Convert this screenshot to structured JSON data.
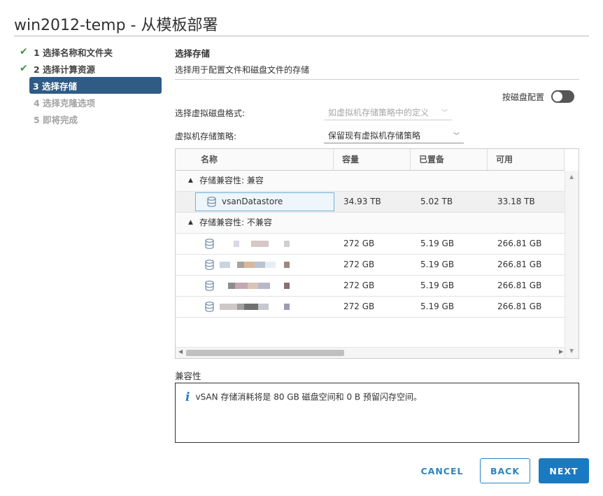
{
  "window": {
    "title": "win2012-temp - 从模板部署"
  },
  "steps": [
    {
      "label": "1 选择名称和文件夹",
      "state": "done"
    },
    {
      "label": "2 选择计算资源",
      "state": "done"
    },
    {
      "label": "3 选择存储",
      "state": "active"
    },
    {
      "label": "4 选择克隆选项",
      "state": "pending"
    },
    {
      "label": "5 即将完成",
      "state": "pending"
    }
  ],
  "section": {
    "title": "选择存储",
    "subtitle": "选择用于配置文件和磁盘文件的存储"
  },
  "toggle": {
    "label": "按磁盘配置",
    "on": false
  },
  "disk_format": {
    "label": "选择虚拟磁盘格式:",
    "value": "如虚拟机存储策略中的定义"
  },
  "vm_policy": {
    "label": "虚拟机存储策略:",
    "value": "保留现有虚拟机存储策略"
  },
  "grid": {
    "columns": [
      "名称",
      "容量",
      "已置备",
      "可用"
    ],
    "groups": [
      {
        "label": "存储兼容性: 兼容",
        "rows": [
          {
            "name": "vsanDatastore",
            "capacity": "34.93 TB",
            "provisioned": "5.02 TB",
            "free": "33.18 TB"
          }
        ]
      },
      {
        "label": "存储兼容性: 不兼容",
        "rows": [
          {
            "name": "",
            "capacity": "272 GB",
            "provisioned": "5.19 GB",
            "free": "266.81 GB"
          },
          {
            "name": "",
            "capacity": "272 GB",
            "provisioned": "5.19 GB",
            "free": "266.81 GB"
          },
          {
            "name": "",
            "capacity": "272 GB",
            "provisioned": "5.19 GB",
            "free": "266.81 GB"
          },
          {
            "name": "",
            "capacity": "272 GB",
            "provisioned": "5.19 GB",
            "free": "266.81 GB"
          }
        ]
      }
    ]
  },
  "compatibility": {
    "label": "兼容性",
    "message": "vSAN 存储消耗将是 80 GB 磁盘空间和 0 B 预留闪存空间。"
  },
  "buttons": {
    "cancel": "CANCEL",
    "back": "BACK",
    "next": "NEXT"
  },
  "colors": {
    "accent": "#1a7ac1",
    "active_step": "#2f5b85",
    "check": "#3d9a41"
  }
}
